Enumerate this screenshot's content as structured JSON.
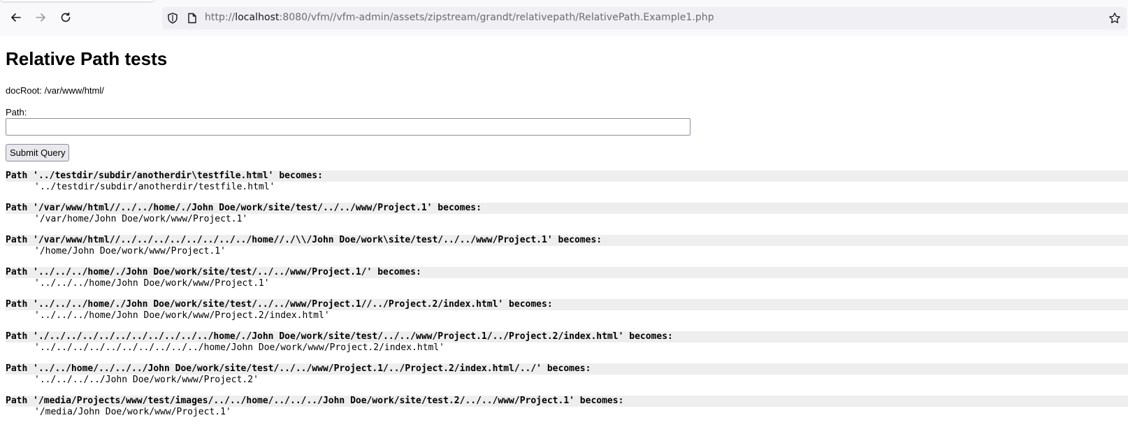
{
  "browser": {
    "url_prefix": "http://",
    "url_host": "localhost",
    "url_rest": ":8080/vfm//vfm-admin/assets/zipstream/grandt/relativepath/RelativePath.Example1.php"
  },
  "page": {
    "title": "Relative Path tests",
    "docroot": "docRoot: /var/www/html/",
    "path_label": "Path:",
    "path_value": "",
    "submit_label": "Submit Query"
  },
  "results": [
    {
      "src": "Path '../testdir/subdir/anotherdir\\testfile.html' becomes:",
      "dst": "'../testdir/subdir/anotherdir/testfile.html'"
    },
    {
      "src": "Path '/var/www/html//../../home/./John Doe/work/site/test/../../www/Project.1' becomes:",
      "dst": "'/var/home/John Doe/work/www/Project.1'"
    },
    {
      "src": "Path '/var/www/html//../../../../../../../../home//./\\\\/John Doe/work\\site/test/../../www/Project.1' becomes:",
      "dst": "'/home/John Doe/work/www/Project.1'"
    },
    {
      "src": "Path '../../../home/./John Doe/work/site/test/../../www/Project.1/' becomes:",
      "dst": "'../../../home/John Doe/work/www/Project.1'"
    },
    {
      "src": "Path '../../../home/./John Doe/work/site/test/../../www/Project.1//../Project.2/index.html' becomes:",
      "dst": "'../../../home/John Doe/work/www/Project.2/index.html'"
    },
    {
      "src": "Path './../../../../../../../../../../home/./John Doe/work/site/test/../../www/Project.1/../Project.2/index.html' becomes:",
      "dst": "'../../../../../../../../../../home/John Doe/work/www/Project.2/index.html'"
    },
    {
      "src": "Path '../../home/../../../John Doe/work/site/test/../../www/Project.1/../Project.2/index.html/../' becomes:",
      "dst": "'../../../../John Doe/work/www/Project.2'"
    },
    {
      "src": "Path '/media/Projects/www/test/images/../../home/../../../John Doe/work/site/test.2/../../www/Project.1' becomes:",
      "dst": "'/media/John Doe/work/www/Project.1'"
    }
  ]
}
